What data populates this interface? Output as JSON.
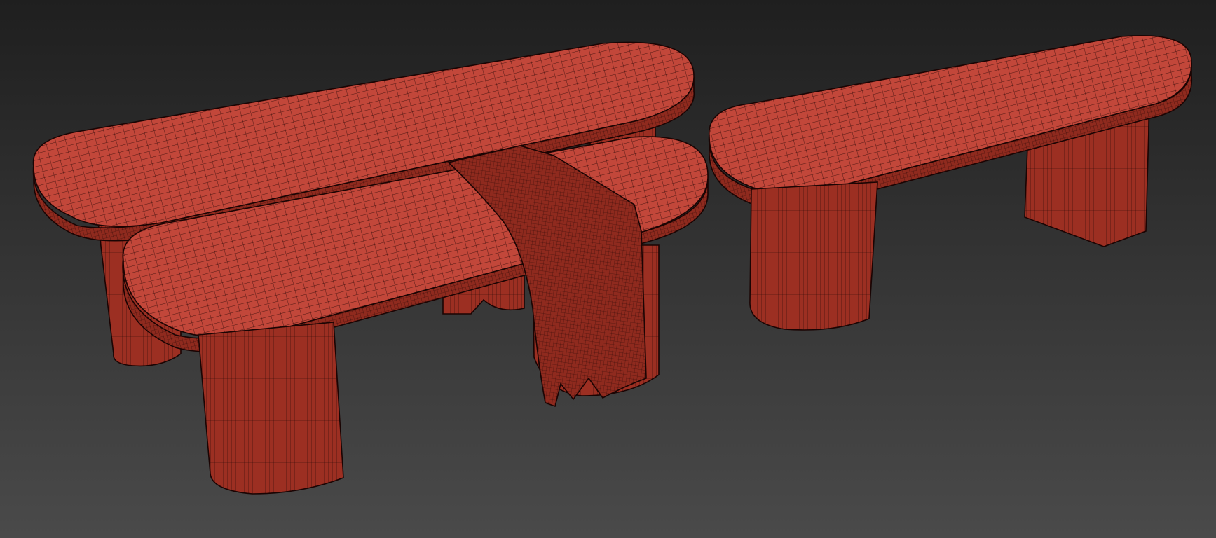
{
  "viewport": {
    "background_top": "#1f1f1f",
    "background_bottom": "#4a4a4a",
    "shading_mode": "wireframe-over-shaded"
  },
  "material": {
    "base_color": "#b23a2a",
    "top_color": "#c2473a",
    "side_color": "#8f2a1e",
    "leg_color": "#9c2f22",
    "wire_color": "#2a0806",
    "shadow_color": "#1a0403"
  },
  "objects": [
    {
      "id": "bench-back-left",
      "type": "bench",
      "legs": "cylindrical"
    },
    {
      "id": "bench-front-left",
      "type": "bench",
      "legs": "cylindrical"
    },
    {
      "id": "throw-blanket",
      "type": "cloth"
    },
    {
      "id": "bench-right",
      "type": "bench",
      "legs": "cylindrical-and-slab"
    }
  ]
}
